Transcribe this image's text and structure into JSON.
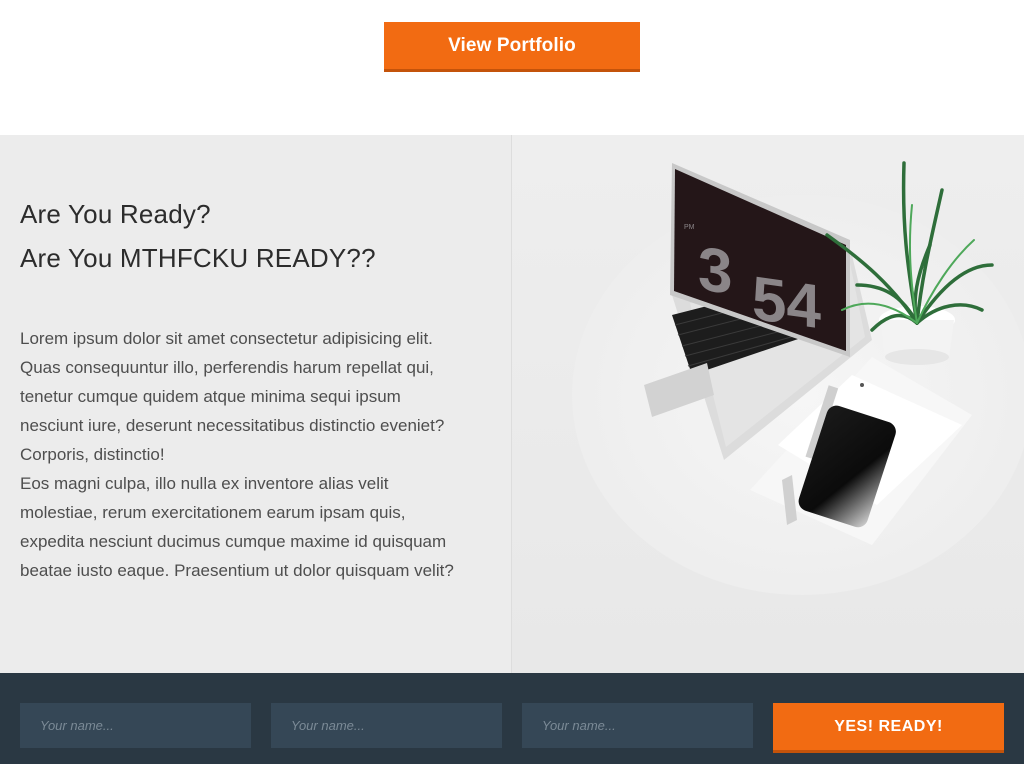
{
  "top": {
    "portfolio_button_label": "View Portfolio"
  },
  "hero": {
    "headline_line1": "Are You Ready?",
    "headline_line2": "Are You MTHFCKU READY??",
    "paragraph1": "Lorem ipsum dolor sit amet consectetur adipisicing elit. Quas consequuntur illo, perferendis harum repellat qui, tenetur cumque quidem atque minima sequi ipsum nesciunt iure, deserunt necessitatibus distinctio eveniet? Corporis, distinctio!",
    "paragraph2": "Eos magni culpa, illo nulla ex inventore alias velit molestiae, rerum exercitationem earum ipsam quis, expedita nesciunt ducimus cumque maxime id quisquam beatae iusto eaque. Praesentium ut dolor quisquam velit?",
    "image": {
      "clock_hour": "3",
      "clock_minute": "54",
      "clock_period": "PM"
    }
  },
  "form": {
    "fields": [
      {
        "placeholder": "Your name...",
        "value": ""
      },
      {
        "placeholder": "Your name...",
        "value": ""
      },
      {
        "placeholder": "Your name...",
        "value": ""
      }
    ],
    "submit_label": "YES! READY!"
  },
  "colors": {
    "accent": "#f26b12",
    "hero_background": "#ececec",
    "footer_background": "#2a3843",
    "field_background": "#354756"
  }
}
